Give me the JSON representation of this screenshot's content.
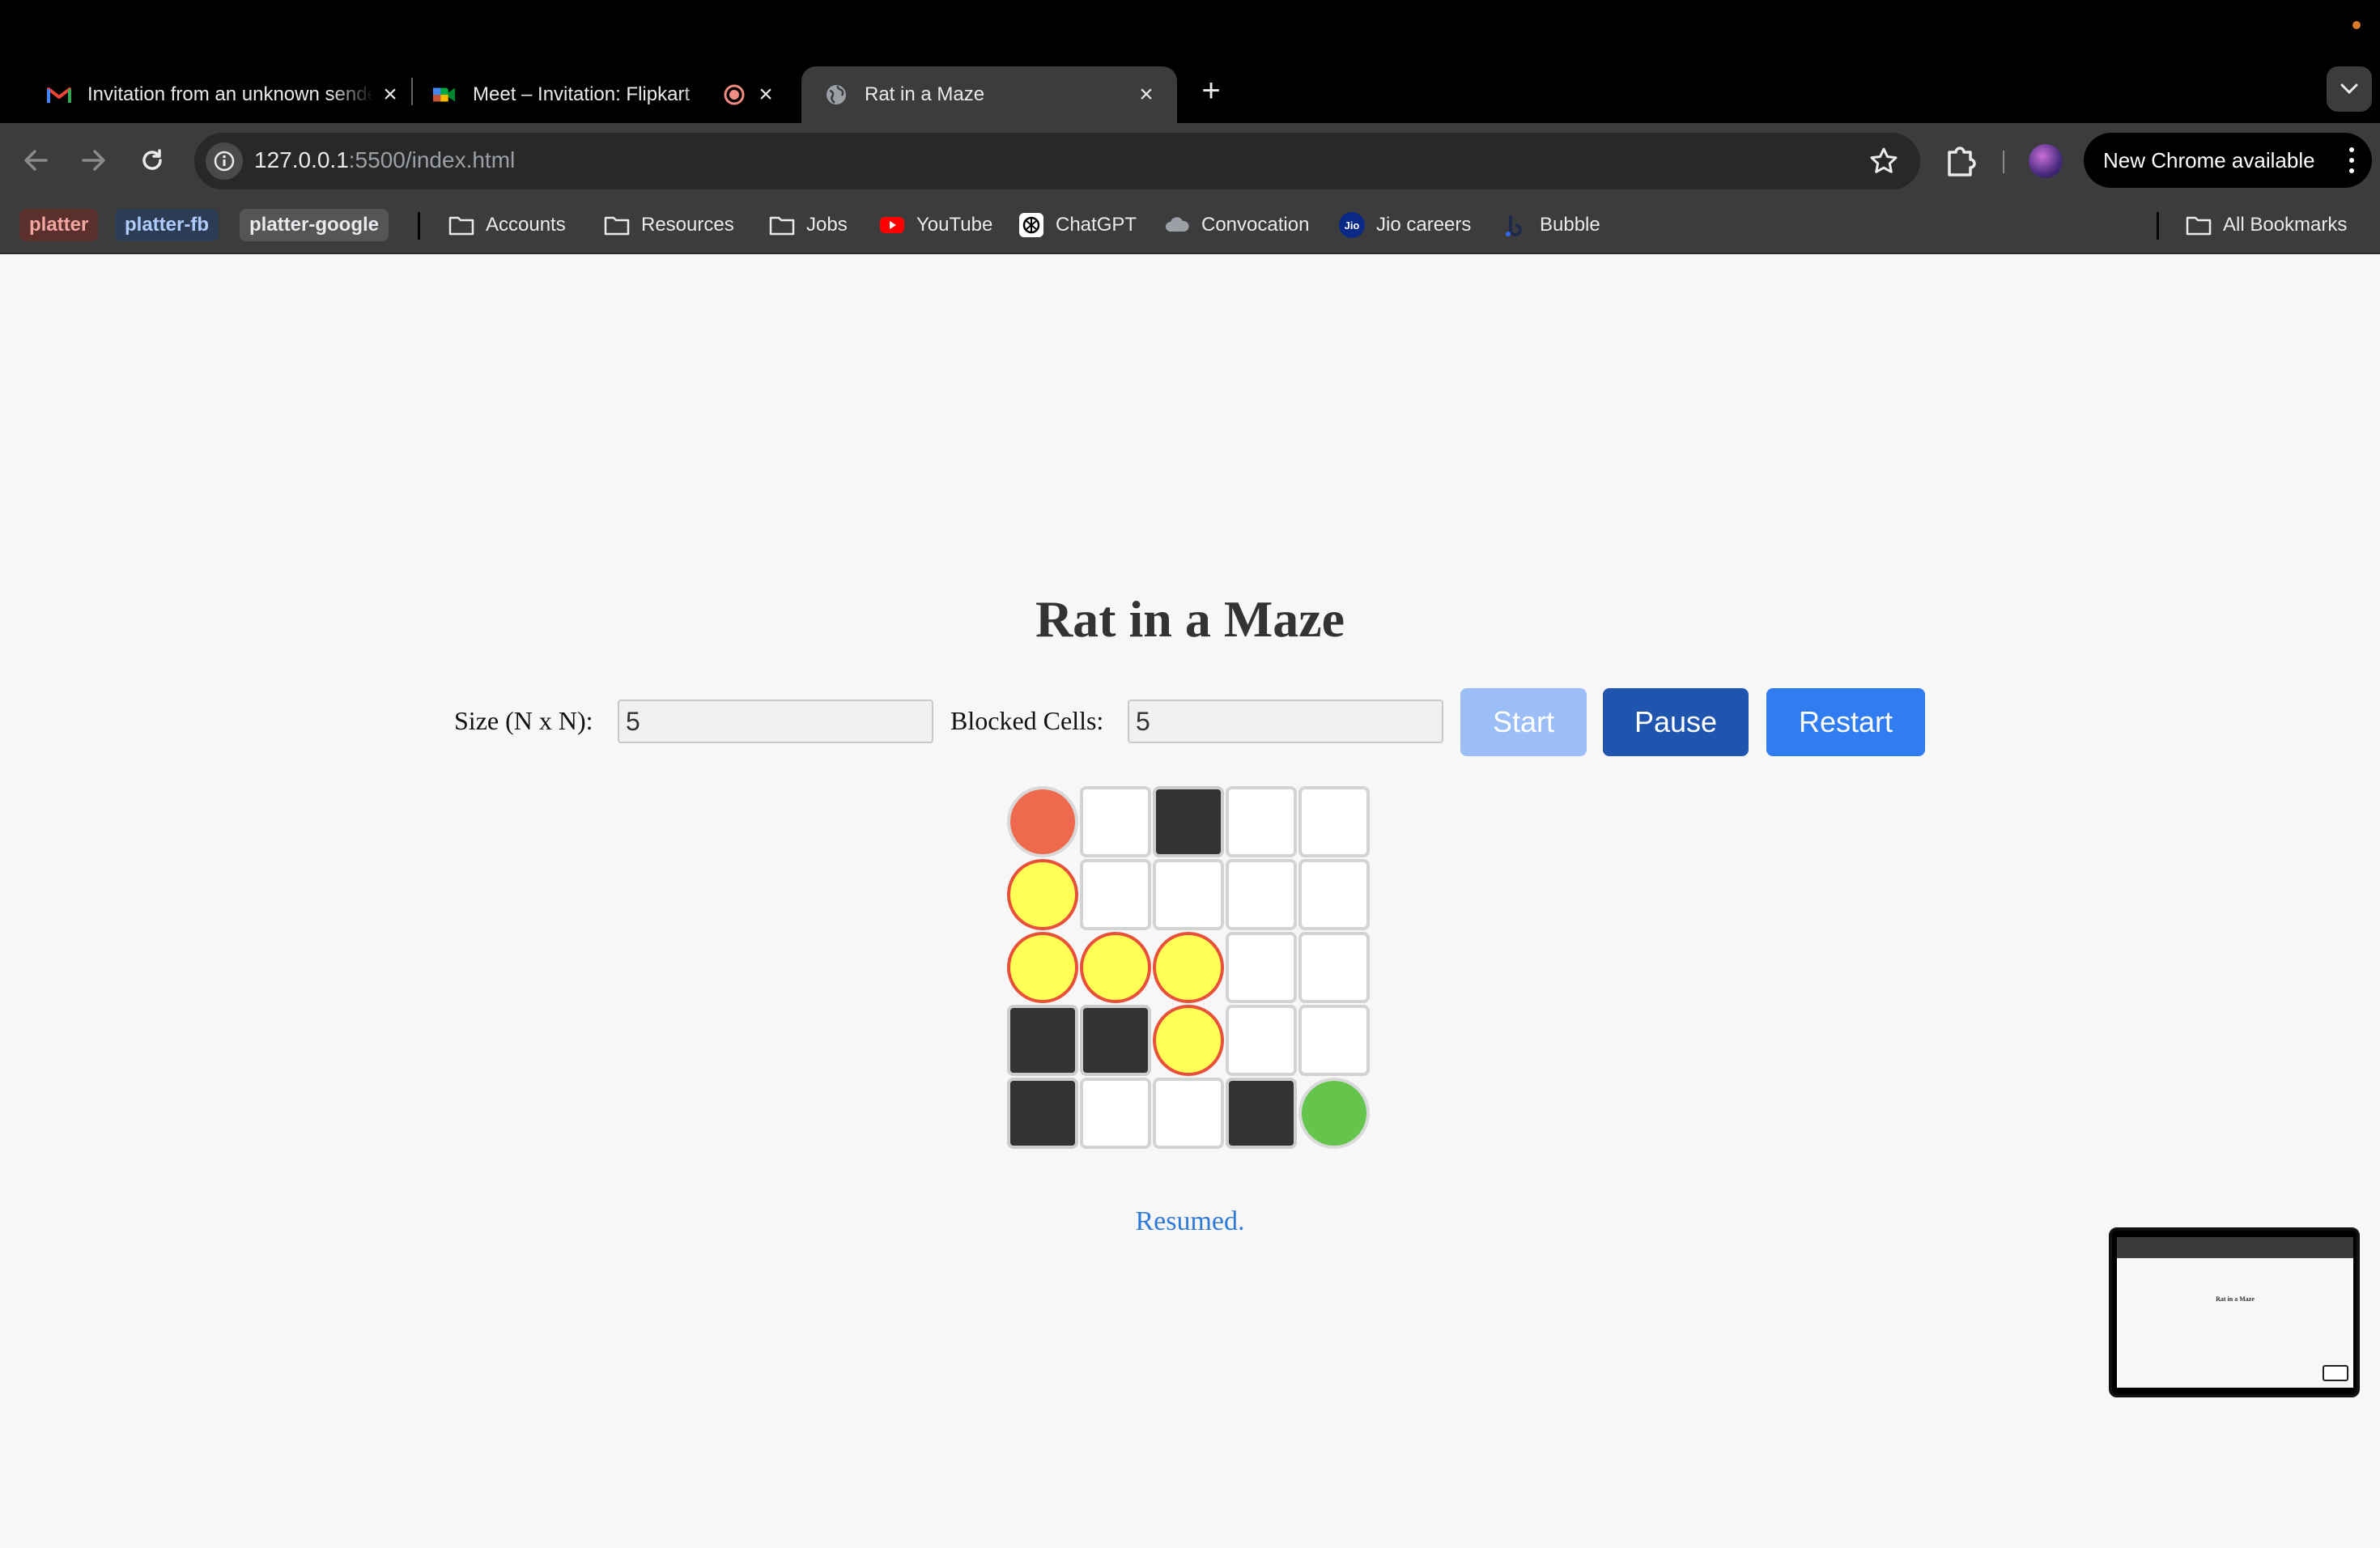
{
  "browser": {
    "tabs": [
      {
        "title": "Invitation from an unknown sender",
        "icon": "gmail-icon",
        "active": false
      },
      {
        "title": "Meet – Invitation: Flipkart",
        "icon": "google-meet-icon",
        "active": false
      },
      {
        "title": "Rat in a Maze",
        "icon": "globe-icon",
        "active": true
      }
    ],
    "new_tab_symbol": "+",
    "url_host": "127.0.0.1",
    "url_path": ":5500/index.html",
    "update_label": "New Chrome available",
    "bookmark_chips": [
      {
        "label": "platter",
        "color": "#f2a7a0",
        "bg": "#5a2f2c"
      },
      {
        "label": "platter-fb",
        "color": "#aecbfa",
        "bg": "#2d3c55"
      },
      {
        "label": "platter-google",
        "color": "#e8eaed",
        "bg": "#555555"
      }
    ],
    "bookmarks": [
      {
        "label": "Accounts",
        "icon": "folder-icon"
      },
      {
        "label": "Resources",
        "icon": "folder-icon"
      },
      {
        "label": "Jobs",
        "icon": "folder-icon"
      },
      {
        "label": "YouTube",
        "icon": "youtube-icon"
      },
      {
        "label": "ChatGPT",
        "icon": "chatgpt-icon"
      },
      {
        "label": "Convocation",
        "icon": "cloud-icon"
      },
      {
        "label": "Jio careers",
        "icon": "jio-icon",
        "icon_text": "Jio"
      },
      {
        "label": "Bubble",
        "icon": "bubble-icon"
      }
    ],
    "all_bookmarks_label": "All Bookmarks"
  },
  "app": {
    "title": "Rat in a Maze",
    "size_label": "Size (N x N):",
    "size_value": "5",
    "blocked_label": "Blocked Cells:",
    "blocked_value": "5",
    "start_label": "Start",
    "pause_label": "Pause",
    "restart_label": "Restart",
    "status": "Resumed.",
    "maze": [
      [
        "rat",
        "open",
        "blocked",
        "open",
        "open"
      ],
      [
        "path",
        "open",
        "open",
        "open",
        "open"
      ],
      [
        "path",
        "path",
        "path",
        "open",
        "open"
      ],
      [
        "blocked",
        "blocked",
        "path",
        "open",
        "open"
      ],
      [
        "blocked",
        "open",
        "open",
        "blocked",
        "goal"
      ]
    ],
    "colors": {
      "rat": "#ed6a4f",
      "path": "#ffff55",
      "path_border": "#e8503a",
      "blocked": "#333333",
      "goal": "#64c44c",
      "start_button": "#9bbef7",
      "pause_button": "#1f55ae",
      "restart_button": "#2f7df0",
      "status_text": "#2f7ad8"
    }
  }
}
